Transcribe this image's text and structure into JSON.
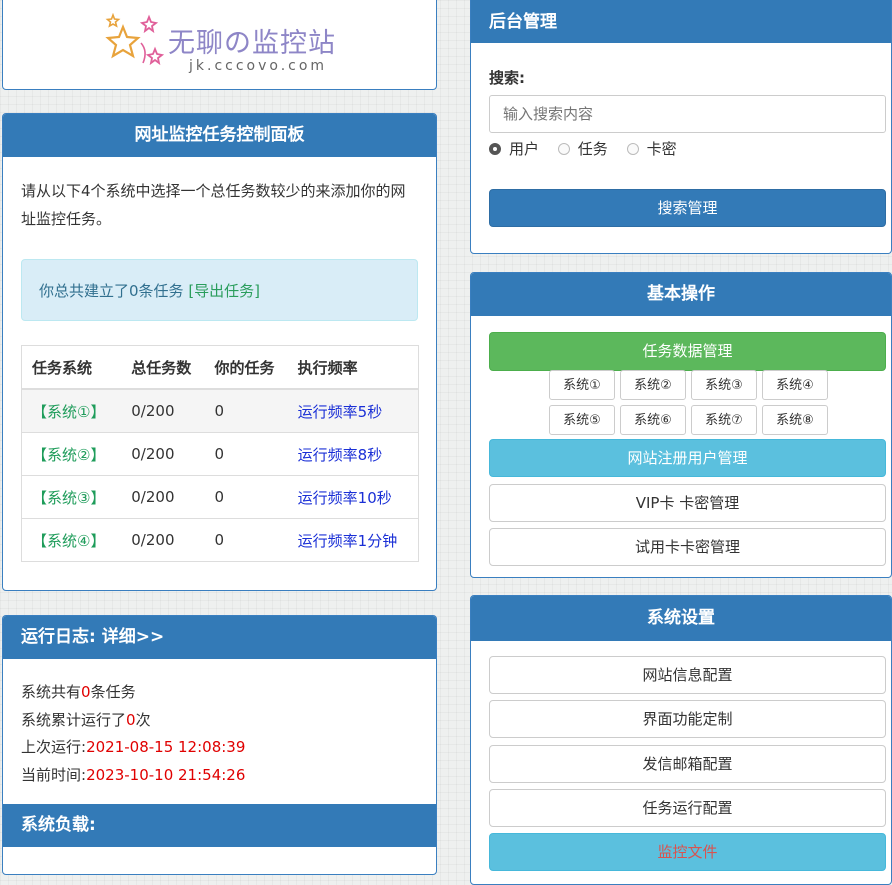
{
  "logo": {
    "title": "无聊の监控站",
    "url": "jk.cccovo.com"
  },
  "task_panel": {
    "title": "网址监控任务控制面板",
    "intro": "请从以下4个系统中选择一个总任务数较少的来添加你的网址监控任务。",
    "alert_text": "你总共建立了0条任务 ",
    "alert_link": "[导出任务]",
    "columns": [
      "任务系统",
      "总任务数",
      "你的任务",
      "执行频率"
    ],
    "rows": [
      {
        "system": "【系统①】",
        "total": "0/200",
        "mine": "0",
        "freq": "运行频率5秒"
      },
      {
        "system": "【系统②】",
        "total": "0/200",
        "mine": "0",
        "freq": "运行频率8秒"
      },
      {
        "system": "【系统③】",
        "total": "0/200",
        "mine": "0",
        "freq": "运行频率10秒"
      },
      {
        "system": "【系统④】",
        "total": "0/200",
        "mine": "0",
        "freq": "运行频率1分钟"
      }
    ]
  },
  "log_panel": {
    "title": "运行日志: 详细>>",
    "l1_pre": "系统共有",
    "l1_val": "0",
    "l1_post": "条任务",
    "l2_pre": "系统累计运行了",
    "l2_val": "0",
    "l2_post": "次",
    "l3_pre": "上次运行:",
    "l3_val": "2021-08-15 12:08:39",
    "l4_pre": "当前时间:",
    "l4_val": "2023-10-10 21:54:26",
    "load_title": "系统负载:"
  },
  "admin": {
    "title": "后台管理",
    "search_label": "搜索:",
    "search_placeholder": "输入搜索内容",
    "radio_user": "用户",
    "radio_task": "任务",
    "radio_card": "卡密",
    "search_button": "搜索管理"
  },
  "ops": {
    "title": "基本操作",
    "task_data_button": "任务数据管理",
    "systems": [
      "系统①",
      "系统②",
      "系统③",
      "系统④",
      "系统⑤",
      "系统⑥",
      "系统⑦",
      "系统⑧"
    ],
    "user_button": "网站注册用户管理",
    "vip_button": "VIP卡 卡密管理",
    "trial_button": "试用卡卡密管理"
  },
  "settings": {
    "title": "系统设置",
    "site_info": "网站信息配置",
    "ui_custom": "界面功能定制",
    "mail_config": "发信邮箱配置",
    "task_config": "任务运行配置",
    "monitor_file": "监控文件"
  },
  "colors": {
    "primary": "#337ab7",
    "success": "#5cb85c",
    "info": "#5bc0de",
    "link_green": "#1e9c5a",
    "link_blue": "#1a2fd6",
    "red": "#e00000"
  }
}
